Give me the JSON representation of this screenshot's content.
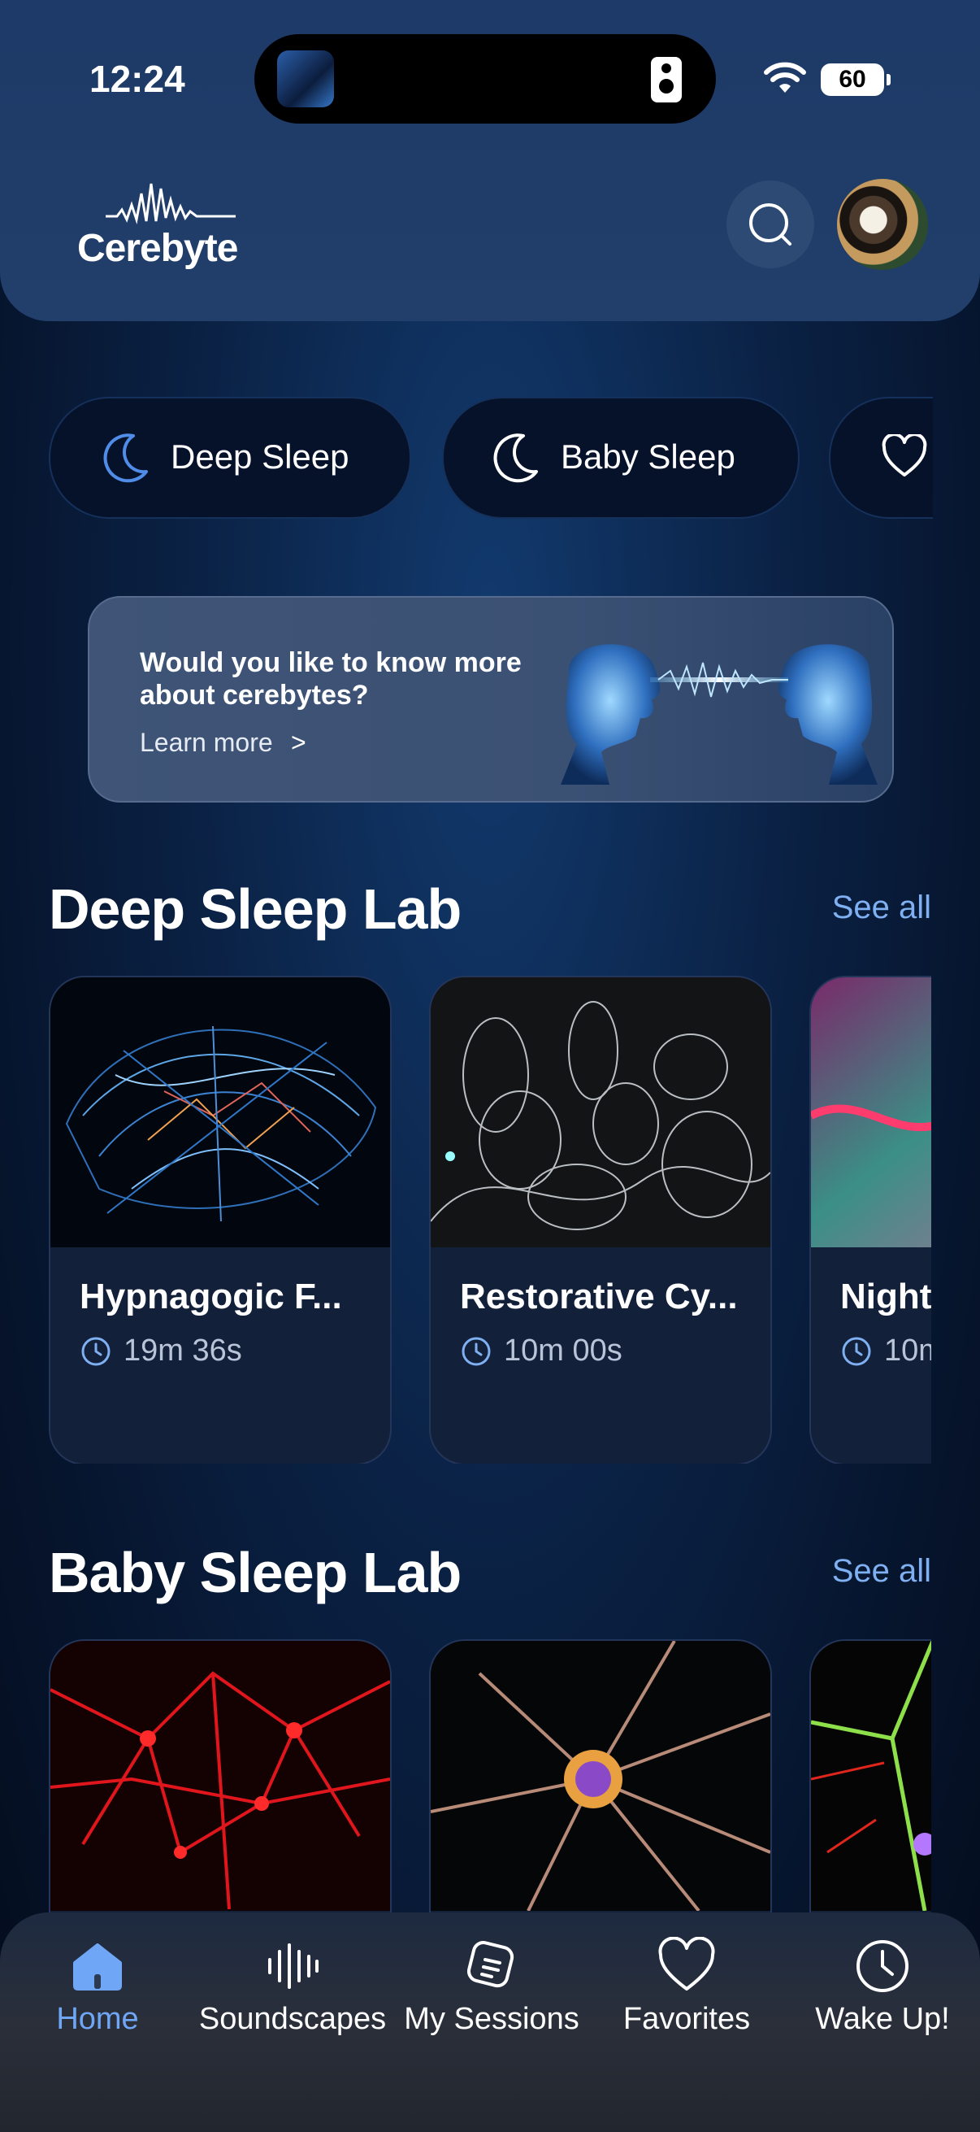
{
  "status_bar": {
    "time": "12:24",
    "battery": "60"
  },
  "brand": {
    "name": "Cerebyte"
  },
  "chips": [
    {
      "label": "Deep Sleep",
      "icon": "moon-icon",
      "active": true
    },
    {
      "label": "Baby Sleep",
      "icon": "moon-icon",
      "active": false
    },
    {
      "label": "",
      "icon": "heart-icon",
      "active": false
    }
  ],
  "promo": {
    "question": "Would you like to know more about cerebytes?",
    "link": "Learn more",
    "link_chevron": ">"
  },
  "sections": [
    {
      "title": "Deep Sleep Lab",
      "see_all": "See all",
      "cards": [
        {
          "title": "Hypnagogic F...",
          "duration": "19m 36s"
        },
        {
          "title": "Restorative Cy...",
          "duration": "10m 00s"
        },
        {
          "title": "Night",
          "duration": "10m"
        }
      ]
    },
    {
      "title": "Baby Sleep Lab",
      "see_all": "See all",
      "cards": [
        {
          "title": "",
          "duration": ""
        },
        {
          "title": "",
          "duration": ""
        },
        {
          "title": "",
          "duration": ""
        }
      ]
    }
  ],
  "tabs": [
    {
      "label": "Home",
      "icon": "home-icon",
      "active": true
    },
    {
      "label": "Soundscapes",
      "icon": "soundwave-icon",
      "active": false
    },
    {
      "label": "My Sessions",
      "icon": "sessions-icon",
      "active": false
    },
    {
      "label": "Favorites",
      "icon": "heart-icon",
      "active": false
    },
    {
      "label": "Wake Up!",
      "icon": "clock-icon",
      "active": false
    }
  ],
  "colors": {
    "accent": "#6fa6f5",
    "chip_bg": "#06122a",
    "card_bg": "#13203a"
  }
}
